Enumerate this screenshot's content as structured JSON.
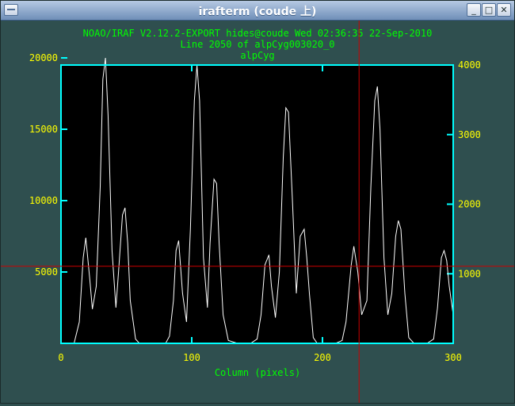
{
  "window": {
    "title": "irafterm (coude 上)",
    "buttons": {
      "menu": "window-menu",
      "minimize": "_",
      "maximize": "□",
      "close": "✕"
    }
  },
  "plot": {
    "header_line1": "NOAO/IRAF V2.12.2-EXPORT hides@coude Wed 02:36:35 22-Sep-2010",
    "header_line2": "Line 2050 of alpCyg003020_0",
    "header_line3": "alpCyg",
    "xlabel": "Column (pixels)",
    "colors": {
      "text": "#00ff00",
      "ticks": "#ffff00",
      "frame": "#00ffff",
      "trace": "#ffffff",
      "cursor": "#cc0000",
      "background": "#000000",
      "window_bg": "#2f4f4f"
    }
  },
  "chart_data": {
    "type": "line",
    "title": "alpCyg",
    "xlabel": "Column (pixels)",
    "ylabel": "",
    "xlim": [
      0,
      300
    ],
    "ylim": [
      0,
      19500
    ],
    "ylim_right": [
      0,
      4000
    ],
    "x_ticks": [
      0,
      100,
      200,
      300
    ],
    "y_ticks_left": [
      5000,
      10000,
      15000,
      20000
    ],
    "y_ticks_right": [
      1000,
      2000,
      3000,
      4000
    ],
    "grid": false,
    "cursor": {
      "x": 228,
      "y": 5400
    },
    "series": [
      {
        "x": [
          0,
          10,
          14,
          17,
          19,
          22,
          24,
          27,
          30,
          32,
          34,
          36,
          39,
          42,
          44,
          47,
          49,
          51,
          53,
          57,
          60,
          65,
          75,
          80,
          83,
          86,
          88,
          90,
          93,
          96,
          99,
          102,
          104,
          106,
          109,
          112,
          114,
          117,
          119,
          121,
          124,
          128,
          135,
          145,
          150,
          153,
          156,
          159,
          161,
          164,
          167,
          170,
          172,
          174,
          177,
          180,
          183,
          186,
          188,
          190,
          193,
          196,
          200,
          210,
          215,
          218,
          222,
          224,
          227,
          230,
          234,
          237,
          240,
          242,
          244,
          247,
          250,
          253,
          256,
          258,
          260,
          263,
          266,
          270,
          280,
          285,
          288,
          291,
          293,
          295,
          297,
          300
        ],
        "y": [
          0,
          0,
          1500,
          6000,
          7400,
          4500,
          2400,
          4000,
          11000,
          18500,
          20000,
          16000,
          6500,
          2500,
          5000,
          9000,
          9500,
          7000,
          3000,
          300,
          0,
          0,
          0,
          0,
          500,
          3000,
          6500,
          7200,
          3500,
          1500,
          8000,
          17000,
          19500,
          17000,
          6000,
          2500,
          7000,
          11500,
          11200,
          7000,
          2000,
          200,
          0,
          0,
          300,
          2000,
          5500,
          6200,
          4000,
          1800,
          5000,
          13000,
          16500,
          16200,
          10000,
          3500,
          7500,
          8000,
          6000,
          3500,
          400,
          0,
          0,
          0,
          200,
          1500,
          5500,
          6800,
          5000,
          2000,
          3000,
          11000,
          17000,
          18000,
          15000,
          6000,
          2000,
          3500,
          7500,
          8600,
          8000,
          3500,
          400,
          0,
          0,
          300,
          2500,
          6000,
          6500,
          5800,
          4000,
          2000
        ]
      }
    ]
  }
}
